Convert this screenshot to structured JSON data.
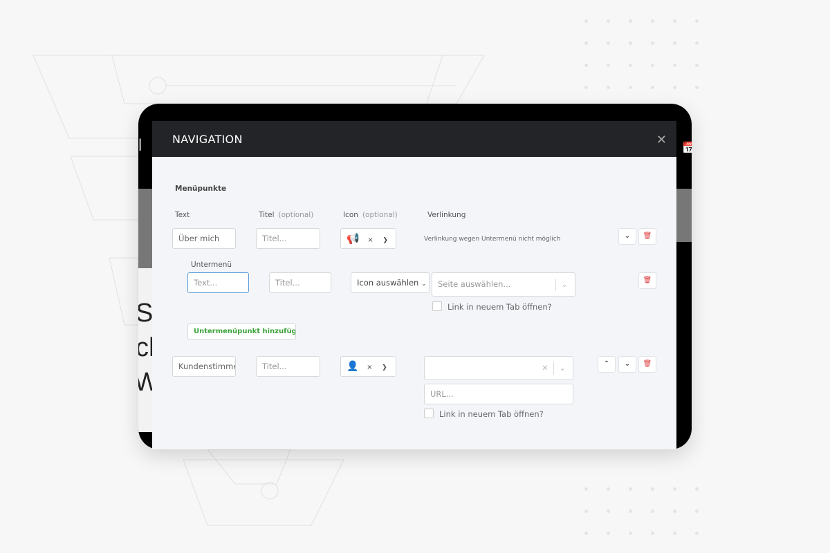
{
  "modal": {
    "title": "NAVIGATION",
    "close_icon": "close-icon"
  },
  "section_title": "Menüpunkte",
  "columns": {
    "text": "Text",
    "title": "Titel",
    "title_opt": "(optional)",
    "icon": "Icon",
    "icon_opt": "(optional)",
    "link": "Verlinkung"
  },
  "items": [
    {
      "text": "Über mich",
      "title_placeholder": "Titel...",
      "icon": "megaphone-icon",
      "clear": "×",
      "link_note": "Verlinkung wegen Untermenü nicht möglich"
    },
    {
      "text": "Kundenstimme",
      "title_placeholder": "Titel...",
      "icon": "user-icon",
      "clear": "×",
      "url_placeholder": "URL...",
      "new_tab": "Link in neuem Tab öffnen?"
    }
  ],
  "submenu": {
    "label": "Untermenü",
    "text_placeholder": "Text...",
    "title_placeholder": "Titel...",
    "icon_select": "Icon auswählen",
    "page_placeholder": "Seite auswählen...",
    "new_tab": "Link in neuem Tab öffnen?",
    "add_button": "Untermenüpunkt hinzufügen"
  },
  "background_text": [
    "Si",
    "ch",
    "W",
    "l"
  ],
  "colors": {
    "header": "#232428",
    "body": "#f3f5f9",
    "accent_green": "#3aa33a",
    "danger": "#dd3333"
  }
}
